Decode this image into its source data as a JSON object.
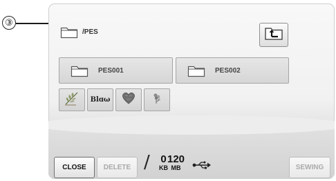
{
  "callout": {
    "number": "③"
  },
  "header": {
    "path": "/PES",
    "up_icon": "folder-up-icon"
  },
  "folders": [
    {
      "label": "PES001",
      "icon": "folder-icon"
    },
    {
      "label": "PES002",
      "icon": "folder-icon"
    }
  ],
  "thumbnails": [
    {
      "icon": "embroidery-leaves-icon"
    },
    {
      "text": "Blɑω",
      "icon": "embroidery-text-icon"
    },
    {
      "icon": "embroidery-heart-icon"
    },
    {
      "icon": "embroidery-flower-icon"
    }
  ],
  "footer": {
    "close_label": "CLOSE",
    "delete_label": "DELETE",
    "used_value": "0",
    "used_unit": "KB",
    "separator": "/",
    "capacity_value": "120",
    "capacity_unit": "MB",
    "usb_icon": "usb-icon",
    "sewing_label": "SEWING"
  },
  "colors": {
    "screen_top": "#f8f8f8",
    "screen_bottom": "#d3d3d3",
    "button_border": "#6f6f6f",
    "disabled_text": "#aaaaaa"
  }
}
